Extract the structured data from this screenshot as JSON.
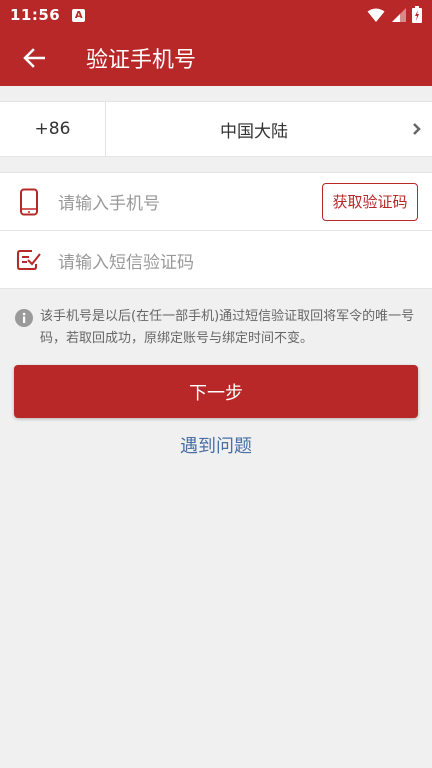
{
  "status_bar": {
    "time": "11:56",
    "app_badge": "A"
  },
  "app_bar": {
    "title": "验证手机号"
  },
  "region": {
    "country_code": "+86",
    "name": "中国大陆"
  },
  "form": {
    "phone_placeholder": "请输入手机号",
    "get_code_label": "获取验证码",
    "code_placeholder": "请输入短信验证码"
  },
  "notice": {
    "text": "该手机号是以后(在任一部手机)通过短信验证取回将军令的唯一号码，若取回成功，原绑定账号与绑定时间不变。"
  },
  "actions": {
    "next_label": "下一步",
    "help_label": "遇到问题"
  },
  "colors": {
    "primary": "#b82828",
    "link": "#4a6fa5",
    "background": "#f0f0f0"
  },
  "icons": [
    "back-arrow-icon",
    "chevron-right-icon",
    "phone-icon",
    "sms-code-icon",
    "info-icon",
    "wifi-icon",
    "signal-icon",
    "battery-icon"
  ]
}
